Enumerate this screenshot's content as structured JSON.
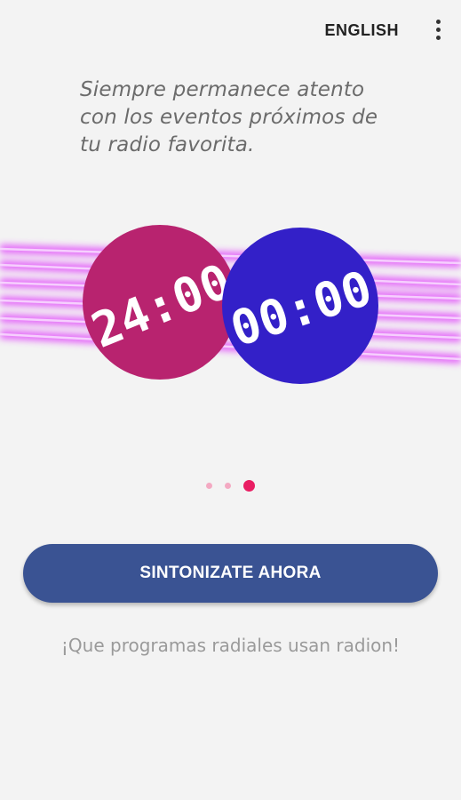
{
  "header": {
    "language_label": "ENGLISH",
    "menu_icon": "more-vert-icon"
  },
  "onboarding": {
    "tagline_lines": [
      "Siempre permanece atento",
      "con los eventos próximos de",
      "tu radio favorita."
    ],
    "clock_left_text": "24:00",
    "clock_right_text": "00:00",
    "page_count": 3,
    "current_page": 3,
    "primary_button_label": "SINTONIZATE AHORA",
    "secondary_link_text": "¡Que programas radiales usan radion!"
  },
  "colors": {
    "background": "#f3f3f3",
    "clock_left": "#b8236f",
    "clock_right": "#3320c8",
    "neon_stripes": "#e040fb",
    "button": "#3a5393",
    "dot_active": "#e91e63",
    "dot_inactive": "#f3a9c2"
  }
}
